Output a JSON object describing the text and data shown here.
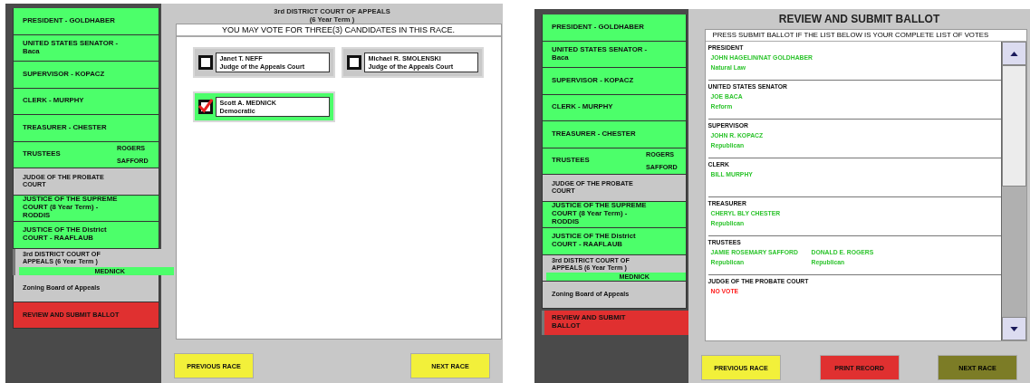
{
  "screens": [
    {
      "sidebar": [
        {
          "label": "PRESIDENT - GOLDHABER",
          "kind": "voted",
          "selected": false
        },
        {
          "label": "UNITED STATES SENATOR - Baca",
          "kind": "voted",
          "selected": false
        },
        {
          "label": "SUPERVISOR - KOPACZ",
          "kind": "voted",
          "selected": false
        },
        {
          "label": "CLERK - MURPHY",
          "kind": "voted",
          "selected": false
        },
        {
          "label": "TREASURER - CHESTER",
          "kind": "voted",
          "selected": false
        },
        {
          "label": "TRUSTEES",
          "kind": "voted",
          "selected": false,
          "choices": [
            "ROGERS",
            "SAFFORD"
          ]
        },
        {
          "label": "JUDGE OF THE PROBATE COURT",
          "kind": "unvoted",
          "selected": false
        },
        {
          "label": "JUSTICE OF THE SUPREME COURT (8 Year Term) - RODDIS",
          "kind": "voted",
          "selected": false
        },
        {
          "label": "JUSTICE OF THE District COURT - RAAFLAUB",
          "kind": "voted",
          "selected": false
        },
        {
          "label": "3rd DISTRICT COURT OF APPEALS (6 Year Term )",
          "kind": "partial",
          "selected": true,
          "choices": [
            "MEDNICK"
          ]
        },
        {
          "label": "Zoning Board of Appeals",
          "kind": "unvoted",
          "selected": false
        },
        {
          "label": "REVIEW AND SUBMIT BALLOT",
          "kind": "review",
          "selected": false
        }
      ],
      "main": {
        "kind": "race",
        "title": [
          "3rd DISTRICT COURT OF APPEALS",
          "(6 Year Term )"
        ],
        "instruction": "YOU MAY VOTE FOR THREE(3) CANDIDATES IN THIS RACE.",
        "candidates": [
          {
            "name": "Janet T. NEFF",
            "party": "Judge of the Appeals Court",
            "checked": false
          },
          {
            "name": "Michael R. SMOLENSKI",
            "party": "Judge of the Appeals Court",
            "checked": false
          },
          {
            "name": "Scott A. MEDNICK",
            "party": "Democratic",
            "checked": true
          }
        ]
      },
      "buttons": [
        {
          "label": "PREVIOUS RACE",
          "kind": "nav",
          "disabled": false
        },
        {
          "label": "NEXT RACE",
          "kind": "nav",
          "disabled": false
        }
      ]
    },
    {
      "sidebar": [
        {
          "label": "PRESIDENT - GOLDHABER",
          "kind": "voted",
          "selected": false
        },
        {
          "label": "UNITED STATES SENATOR - Baca",
          "kind": "voted",
          "selected": false
        },
        {
          "label": "SUPERVISOR - KOPACZ",
          "kind": "voted",
          "selected": false
        },
        {
          "label": "CLERK - MURPHY",
          "kind": "voted",
          "selected": false
        },
        {
          "label": "TREASURER - CHESTER",
          "kind": "voted",
          "selected": false
        },
        {
          "label": "TRUSTEES",
          "kind": "voted",
          "selected": false,
          "choices": [
            "ROGERS",
            "SAFFORD"
          ]
        },
        {
          "label": "JUDGE OF THE PROBATE COURT",
          "kind": "unvoted",
          "selected": false
        },
        {
          "label": "JUSTICE OF THE SUPREME COURT (8 Year Term) - RODDIS",
          "kind": "voted",
          "selected": false
        },
        {
          "label": "JUSTICE OF THE District COURT - RAAFLAUB",
          "kind": "voted",
          "selected": false
        },
        {
          "label": "3rd DISTRICT COURT OF APPEALS (6 Year Term )",
          "kind": "partial",
          "selected": false,
          "choices": [
            "MEDNICK"
          ]
        },
        {
          "label": "Zoning Board of Appeals",
          "kind": "unvoted",
          "selected": false
        },
        {
          "label": "REVIEW AND SUBMIT BALLOT",
          "kind": "review",
          "selected": true
        }
      ],
      "main": {
        "kind": "review",
        "title": [
          "REVIEW AND SUBMIT BALLOT"
        ],
        "instruction": "PRESS SUBMIT BALLOT IF THE LIST BELOW IS YOUR COMPLETE LIST OF VOTES",
        "entries": [
          {
            "race": "PRESIDENT",
            "kind": "vote",
            "selections": [
              {
                "name": "JOHN HAGELIN/NAT GOLDHABER",
                "party": "Natural Law"
              }
            ]
          },
          {
            "race": "UNITED STATES SENATOR",
            "kind": "vote",
            "selections": [
              {
                "name": "JOE BACA",
                "party": "Reform"
              }
            ]
          },
          {
            "race": "SUPERVISOR",
            "kind": "vote",
            "selections": [
              {
                "name": "JOHN R. KOPACZ",
                "party": "Republican"
              }
            ]
          },
          {
            "race": "CLERK",
            "kind": "vote",
            "selections": [
              {
                "name": "BILL MURPHY"
              }
            ]
          },
          {
            "race": "TREASURER",
            "kind": "vote",
            "selections": [
              {
                "name": "CHERYL BLY CHESTER",
                "party": "Republican"
              }
            ]
          },
          {
            "race": "TRUSTEES",
            "kind": "vote",
            "selections": [
              {
                "name": "JAMIE ROSEMARY SAFFORD",
                "party": "Republican"
              },
              {
                "name": "DONALD E. ROGERS",
                "party": "Republican"
              }
            ]
          },
          {
            "race": "JUDGE OF THE PROBATE COURT",
            "kind": "no_vote",
            "selections": [
              {
                "name": "NO VOTE"
              }
            ]
          }
        ]
      },
      "buttons": [
        {
          "label": "PREVIOUS RACE",
          "kind": "nav",
          "disabled": false
        },
        {
          "label": "PRINT RECORD",
          "kind": "print",
          "disabled": false
        },
        {
          "label": "NEXT RACE",
          "kind": "nav",
          "disabled": true
        }
      ]
    }
  ]
}
